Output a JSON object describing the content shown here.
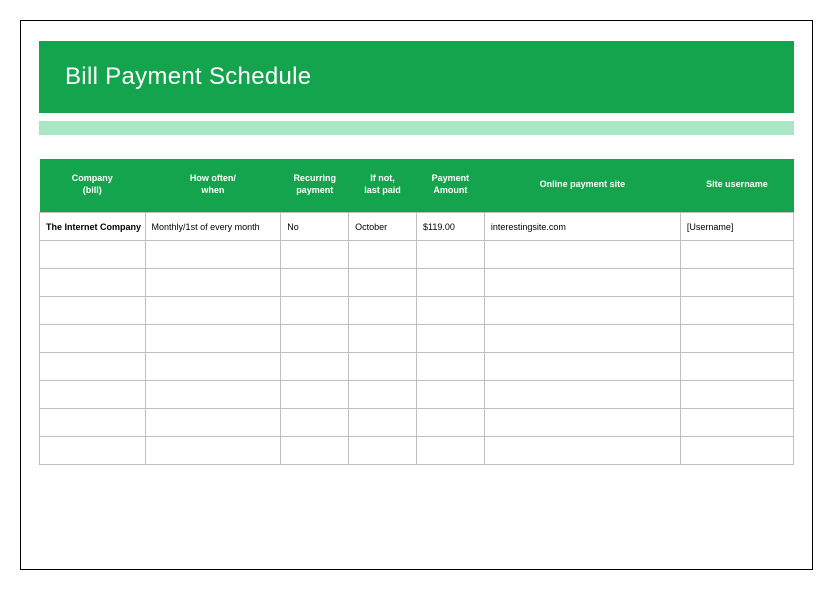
{
  "header": {
    "title": "Bill Payment Schedule"
  },
  "table": {
    "columns": [
      {
        "line1": "Company",
        "line2": "(bill)"
      },
      {
        "line1": "How often/",
        "line2": "when"
      },
      {
        "line1": "Recurring",
        "line2": "payment"
      },
      {
        "line1": "If not,",
        "line2": "last paid"
      },
      {
        "line1": "Payment",
        "line2": "Amount"
      },
      {
        "line1": "Online payment site",
        "line2": ""
      },
      {
        "line1": "Site username",
        "line2": ""
      }
    ],
    "rows": [
      {
        "company": "The Internet Company",
        "howoften": "Monthly/1st of every month",
        "recurring": "No",
        "lastpaid": "October",
        "amount": "$119.00",
        "site": "interestingsite.com",
        "username": "[Username]"
      },
      {
        "company": "",
        "howoften": "",
        "recurring": "",
        "lastpaid": "",
        "amount": "",
        "site": "",
        "username": ""
      },
      {
        "company": "",
        "howoften": "",
        "recurring": "",
        "lastpaid": "",
        "amount": "",
        "site": "",
        "username": ""
      },
      {
        "company": "",
        "howoften": "",
        "recurring": "",
        "lastpaid": "",
        "amount": "",
        "site": "",
        "username": ""
      },
      {
        "company": "",
        "howoften": "",
        "recurring": "",
        "lastpaid": "",
        "amount": "",
        "site": "",
        "username": ""
      },
      {
        "company": "",
        "howoften": "",
        "recurring": "",
        "lastpaid": "",
        "amount": "",
        "site": "",
        "username": ""
      },
      {
        "company": "",
        "howoften": "",
        "recurring": "",
        "lastpaid": "",
        "amount": "",
        "site": "",
        "username": ""
      },
      {
        "company": "",
        "howoften": "",
        "recurring": "",
        "lastpaid": "",
        "amount": "",
        "site": "",
        "username": ""
      },
      {
        "company": "",
        "howoften": "",
        "recurring": "",
        "lastpaid": "",
        "amount": "",
        "site": "",
        "username": ""
      }
    ]
  }
}
